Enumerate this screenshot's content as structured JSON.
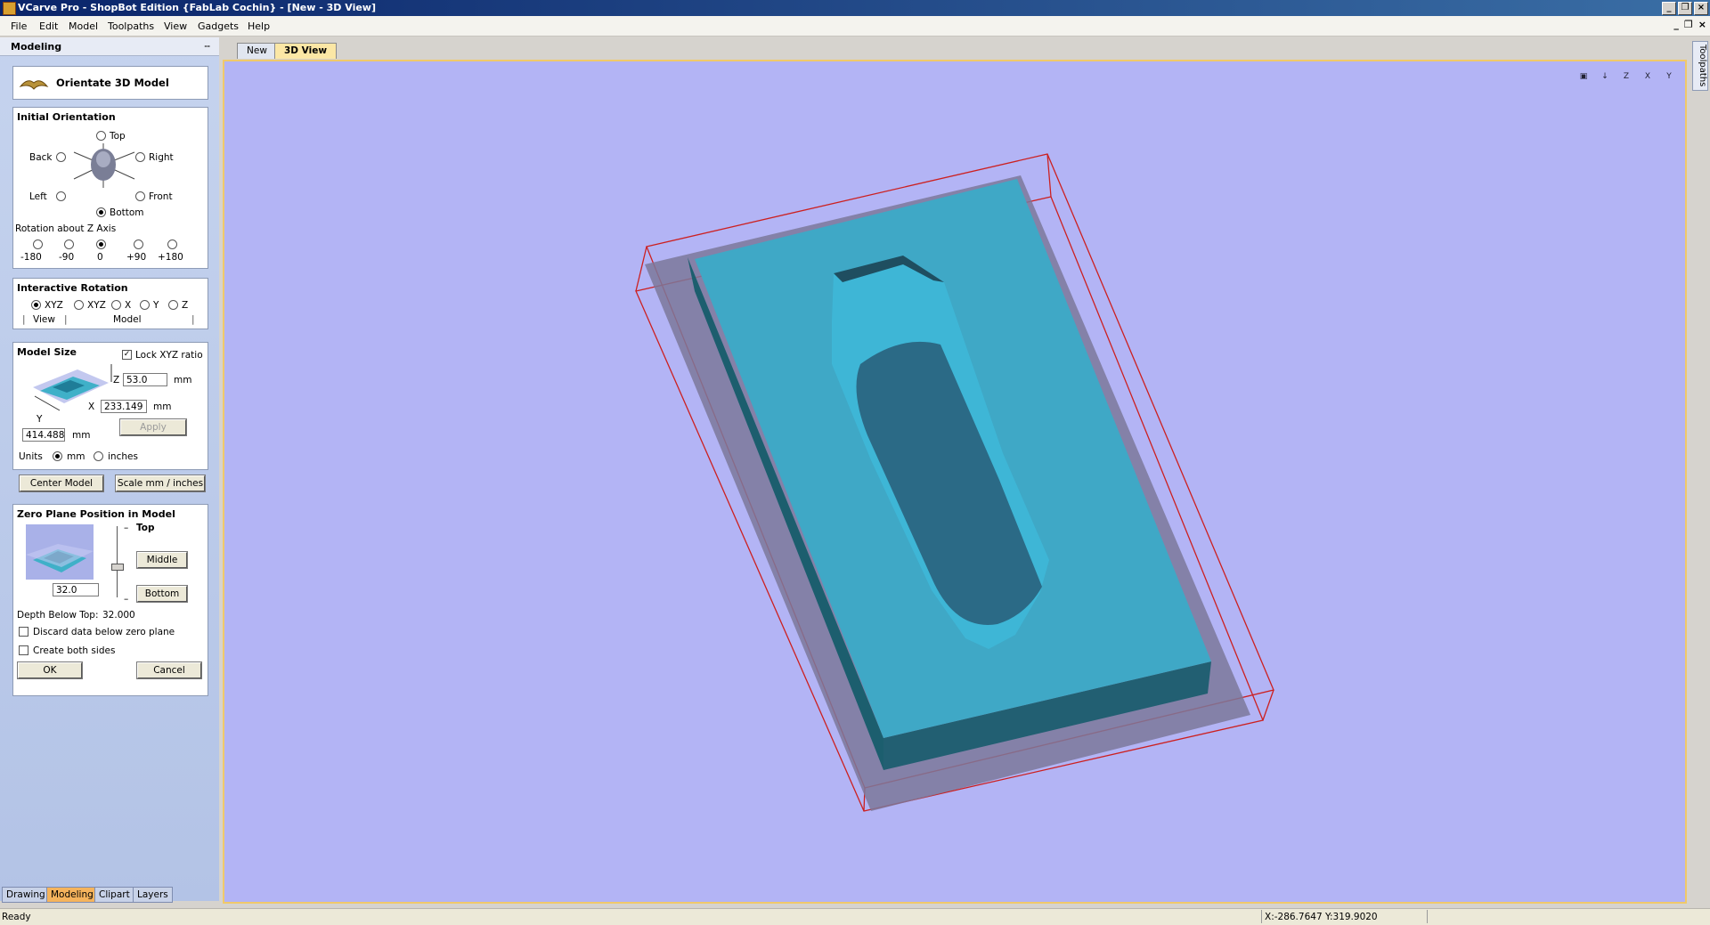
{
  "window": {
    "title": "VCarve Pro - ShopBot Edition {FabLab Cochin} - [New - 3D View]"
  },
  "menu": [
    "File",
    "Edit",
    "Model",
    "Toolpaths",
    "View",
    "Gadgets",
    "Help"
  ],
  "panel": {
    "header": "Modeling",
    "header_pin": "ⵧ",
    "section_title": "Orientate 3D Model",
    "initial_orientation": {
      "title": "Initial Orientation",
      "top": "Top",
      "back": "Back",
      "right": "Right",
      "left": "Left",
      "front": "Front",
      "bottom": "Bottom",
      "rotation_label": "Rotation about Z Axis",
      "rotations": [
        "-180",
        "-90",
        "0",
        "+90",
        "+180"
      ]
    },
    "interactive_rotation": {
      "title": "Interactive Rotation",
      "options": [
        "XYZ",
        "XYZ",
        "X",
        "Y",
        "Z"
      ],
      "view_label": "View",
      "model_label": "Model"
    },
    "model_size": {
      "title": "Model Size",
      "lock_label": "Lock XYZ ratio",
      "z_label": "Z",
      "z_value": "53.0",
      "z_unit": "mm",
      "x_label": "X",
      "x_value": "233.149",
      "x_unit": "mm",
      "y_label": "Y",
      "y_value": "414.488",
      "y_unit": "mm",
      "apply": "Apply",
      "units_label": "Units",
      "mm": "mm",
      "inches": "inches",
      "center_model": "Center Model",
      "scale": "Scale mm / inches"
    },
    "zero_plane": {
      "title": "Zero Plane Position in Model",
      "top": "Top",
      "middle": "Middle",
      "bottom": "Bottom",
      "value": "32.0",
      "depth_label": "Depth Below Top:",
      "depth_value": "32.000",
      "discard": "Discard data below zero plane",
      "both_sides": "Create both sides"
    },
    "ok": "OK",
    "cancel": "Cancel"
  },
  "bottom_tabs": [
    "Drawing",
    "Modeling",
    "Clipart",
    "Layers"
  ],
  "doc_tabs": [
    "New",
    "3D View"
  ],
  "right_tab": "Toolpaths",
  "view_tools": [
    "▣",
    "↓",
    "Z",
    "X",
    "Y"
  ],
  "status": {
    "ready": "Ready",
    "coords": "X:-286.7647 Y:319.9020"
  },
  "colors": {
    "viewport_bg": "#b3b4f5",
    "model": "#3fb8d6",
    "bounding_box": "#cc2020"
  }
}
